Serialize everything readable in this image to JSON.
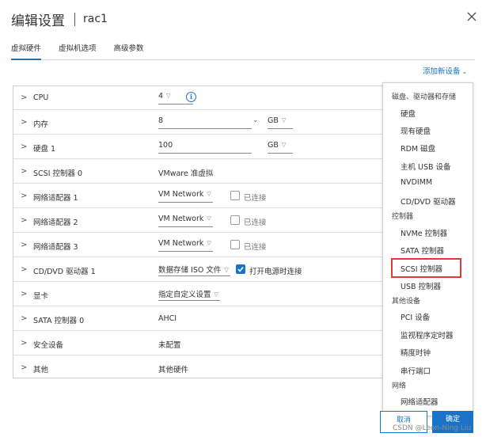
{
  "header": {
    "title": "编辑设置",
    "vm_name": "rac1"
  },
  "tabs": [
    {
      "label": "虚拟硬件",
      "active": true
    },
    {
      "label": "虚拟机选项",
      "active": false
    },
    {
      "label": "高级参数",
      "active": false
    }
  ],
  "add_device": {
    "label": "添加新设备",
    "caret": "⌄"
  },
  "rows": {
    "cpu": {
      "label": "CPU",
      "value": "4",
      "info": "i"
    },
    "memory": {
      "label": "内存",
      "value": "8",
      "unit": "GB"
    },
    "disk1": {
      "label": "硬盘 1",
      "value": "100",
      "unit": "GB"
    },
    "scsi0": {
      "label": "SCSI 控制器 0",
      "value": "VMware 准虚拟"
    },
    "net1": {
      "label": "网络适配器 1",
      "value": "VM Network",
      "connected_label": "已连接",
      "connected": false
    },
    "net2": {
      "label": "网络适配器 2",
      "value": "VM Network",
      "connected_label": "已连接",
      "connected": false
    },
    "net3": {
      "label": "网络适配器 3",
      "value": "VM Network",
      "connected_label": "已连接",
      "connected": false
    },
    "cd1": {
      "label": "CD/DVD 驱动器 1",
      "value": "数据存储 ISO 文件",
      "connect_label": "打开电源时连接",
      "connected": true
    },
    "gpu": {
      "label": "显卡",
      "value": "指定自定义设置"
    },
    "sata0": {
      "label": "SATA 控制器 0",
      "value": "AHCI"
    },
    "security": {
      "label": "安全设备",
      "value": "未配置"
    },
    "other": {
      "label": "其他",
      "value": "其他硬件"
    }
  },
  "menu": {
    "storage_header": "磁盘、驱动器和存储",
    "storage": [
      "硬盘",
      "现有硬盘",
      "RDM 磁盘",
      "主机 USB 设备",
      "NVDIMM",
      "CD/DVD 驱动器"
    ],
    "controllers_header": "控制器",
    "controllers": [
      "NVMe 控制器",
      "SATA 控制器",
      "SCSI 控制器",
      "USB 控制器"
    ],
    "other_header": "其他设备",
    "other": [
      "PCI 设备",
      "监视程序定时器",
      "精度时钟",
      "串行端口"
    ],
    "network_header": "网络",
    "network": [
      "网络适配器"
    ],
    "highlighted": "SCSI 控制器"
  },
  "footer": {
    "cancel_label": "取消",
    "ok_label": "确定"
  },
  "watermark": "CSDN @Leon-Ning Liu",
  "colors": {
    "accent": "#1a73c8",
    "highlight": "#e53935"
  }
}
